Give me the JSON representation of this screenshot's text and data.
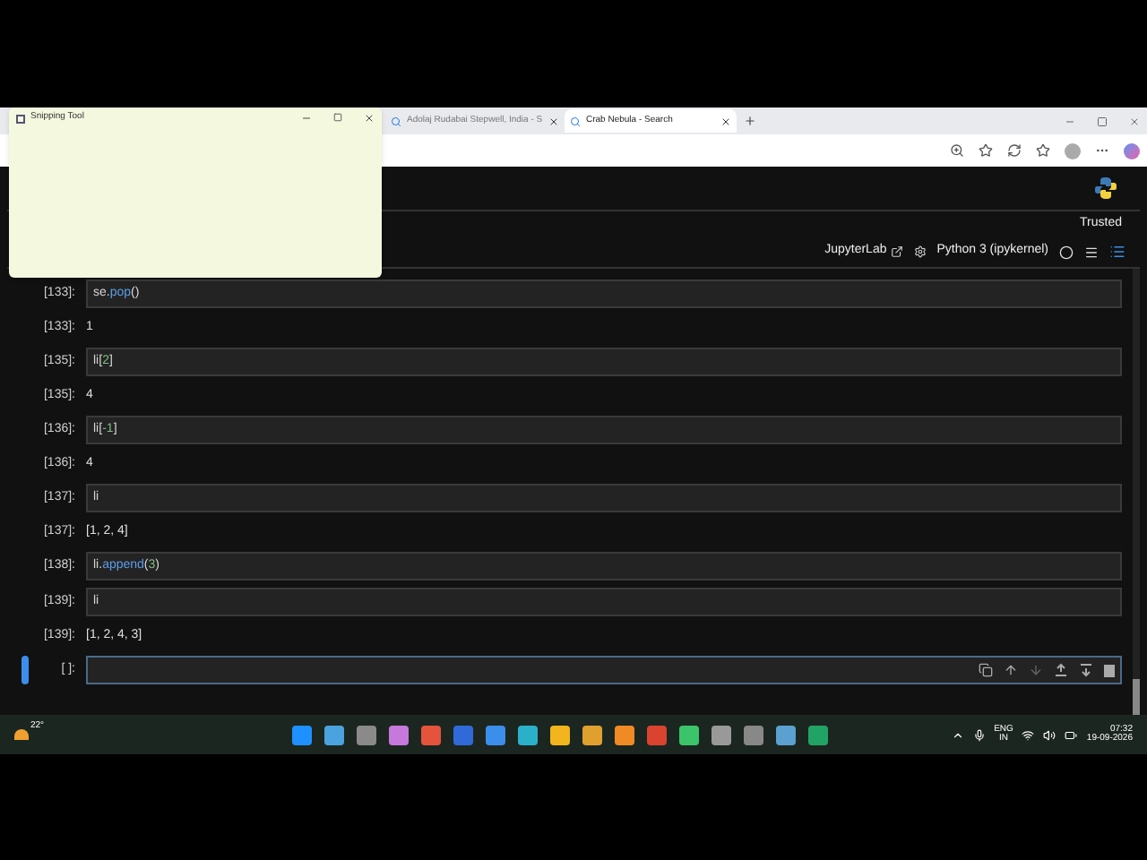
{
  "snipping_tool": {
    "title": "Snipping Tool"
  },
  "browser": {
    "tabs": [
      {
        "title": "Adolaj Rudabai Stepwell, India - S",
        "selected": false
      },
      {
        "title": "Crab Nebula - Search",
        "selected": true
      }
    ]
  },
  "notebook": {
    "trusted": "Trusted",
    "jupyterlab_link": "JupyterLab",
    "kernel": "Python 3 (ipykernel)",
    "cells": [
      {
        "kind": "input",
        "prompt": "[133]:",
        "selected": false,
        "tokens": [
          {
            "text": "se.",
            "kind": "name"
          },
          {
            "text": "pop",
            "kind": "method"
          },
          {
            "text": "()",
            "kind": "name"
          }
        ]
      },
      {
        "kind": "output",
        "prompt": "[133]:",
        "text": "1"
      },
      {
        "kind": "input",
        "prompt": "[135]:",
        "selected": false,
        "tokens": [
          {
            "text": "li",
            "kind": "name"
          },
          {
            "text": "[",
            "kind": "name"
          },
          {
            "text": "2",
            "kind": "number"
          },
          {
            "text": "]",
            "kind": "name"
          }
        ]
      },
      {
        "kind": "output",
        "prompt": "[135]:",
        "text": "4"
      },
      {
        "kind": "input",
        "prompt": "[136]:",
        "selected": false,
        "tokens": [
          {
            "text": "li",
            "kind": "name"
          },
          {
            "text": "[",
            "kind": "name"
          },
          {
            "text": "-1",
            "kind": "number"
          },
          {
            "text": "]",
            "kind": "name"
          }
        ]
      },
      {
        "kind": "output",
        "prompt": "[136]:",
        "text": "4"
      },
      {
        "kind": "input",
        "prompt": "[137]:",
        "selected": false,
        "tokens": [
          {
            "text": "li",
            "kind": "name"
          }
        ]
      },
      {
        "kind": "output",
        "prompt": "[137]:",
        "text": "[1, 2, 4]"
      },
      {
        "kind": "input",
        "prompt": "[138]:",
        "selected": false,
        "tokens": [
          {
            "text": "li.",
            "kind": "name"
          },
          {
            "text": "append",
            "kind": "method"
          },
          {
            "text": "(",
            "kind": "name"
          },
          {
            "text": "3",
            "kind": "number"
          },
          {
            "text": ")",
            "kind": "name"
          }
        ]
      },
      {
        "kind": "input",
        "prompt": "[139]:",
        "selected": false,
        "tokens": [
          {
            "text": "li",
            "kind": "name"
          }
        ]
      },
      {
        "kind": "output",
        "prompt": "[139]:",
        "text": "[1, 2, 4, 3]"
      },
      {
        "kind": "input",
        "prompt": "[ ]:",
        "selected": true
      }
    ]
  },
  "taskbar": {
    "weather": "22°",
    "language": "ENG",
    "region": "IN",
    "time": "07:32",
    "date": "19-09-2026"
  }
}
